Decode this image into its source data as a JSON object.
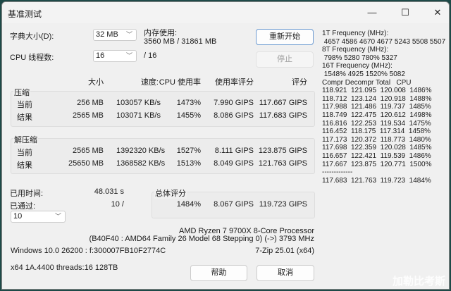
{
  "window": {
    "title": "基准测试",
    "controls": {
      "minimize": "—",
      "maximize": "☐",
      "close": "✕"
    }
  },
  "dict": {
    "label": "字典大小(D):",
    "value": "32 MB"
  },
  "threads": {
    "label": "CPU 线程数:",
    "value": "16",
    "max": "/ 16"
  },
  "memory": {
    "label": "内存使用:",
    "value": "3560 MB / 31861 MB"
  },
  "buttons": {
    "restart": "重新开始",
    "stop": "停止",
    "help": "帮助",
    "cancel": "取消"
  },
  "headers": [
    "大小",
    "速度:",
    "CPU 使用率",
    "使用率评分",
    "评分"
  ],
  "compress": {
    "label": "压缩",
    "rows": [
      {
        "name": "当前",
        "cells": [
          "256 MB",
          "103057 KB/s",
          "1473%",
          "7.990 GIPS",
          "117.667 GIPS"
        ]
      },
      {
        "name": "结果",
        "cells": [
          "2565 MB",
          "103071 KB/s",
          "1455%",
          "8.086 GIPS",
          "117.683 GIPS"
        ]
      }
    ]
  },
  "decompress": {
    "label": "解压缩",
    "rows": [
      {
        "name": "当前",
        "cells": [
          "2565 MB",
          "1392320 KB/s",
          "1527%",
          "8.111 GIPS",
          "123.875 GIPS"
        ]
      },
      {
        "name": "结果",
        "cells": [
          "25650 MB",
          "1368582 KB/s",
          "1513%",
          "8.049 GIPS",
          "121.763 GIPS"
        ]
      }
    ]
  },
  "elapsed": {
    "label": "已用时间:",
    "value": "48.031 s"
  },
  "passed": {
    "label": "已通过:",
    "value": "10 /",
    "select": "10"
  },
  "overall": {
    "label": "总体评分",
    "cells": [
      "1484%",
      "8.067 GIPS",
      "119.723 GIPS"
    ]
  },
  "cpu": {
    "name": "AMD Ryzen 7 9700X 8-Core Processor",
    "detail": "(B40F40 : AMD64 Family 26 Model 68 Stepping 0) (->) 3793 MHz"
  },
  "os": "Windows 10.0 26200 :  f:300007FB10F2774C",
  "version": "7-Zip 25.01 (x64)",
  "arch": "x64 1A.4400 threads:16 128TB",
  "log": "1T Frequency (MHz):\n 4657 4586 4670 4677 5243 5508 5507\n8T Frequency (MHz):\n 798% 5280 780% 5327\n16T Frequency (MHz):\n 1548% 4925 1520% 5082\nCompr Decompr Total   CPU\n118.921  121.095  120.008  1486%\n118.712  123.124  120.918  1488%\n117.988  121.486  119.737  1485%\n118.749  122.475  120.612  1498%\n116.816  122.253  119.534  1475%\n116.452  118.175  117.314  1458%\n117.173  120.372  118.773  1480%\n117.698  122.359  120.028  1485%\n116.657  122.421  119.539  1486%\n117.667  123.875  120.771  1500%\n-------------\n117.683  121.763  119.723  1484%",
  "watermark": "加勒比考斯"
}
